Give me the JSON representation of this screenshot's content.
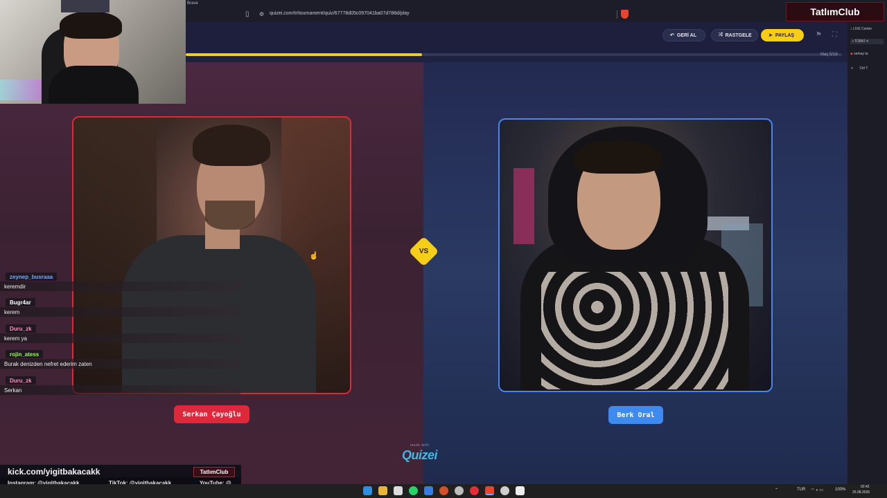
{
  "browser": {
    "app_name": "Brave",
    "url": "quizei.com/tr/tournament/quiz/67778d05c097041ba07d788d/play"
  },
  "header": {
    "back_label": "GERİ AL",
    "random_label": "RASTGELE",
    "share_label": "PAYLAŞ",
    "round_label": "Maç 5/16",
    "progress": 0.36
  },
  "match": {
    "left_name": "Serkan Çayoğlu",
    "right_name": "Berk Oral",
    "vs_label": "VS",
    "made_with": "made with",
    "logo": "Quizei"
  },
  "sidebar": {
    "items": [
      "LIVE Center",
      "TÜRKİ",
      "serkay ta",
      "Ctrl  T"
    ]
  },
  "stream": {
    "brand": "TatlımClub",
    "kick_url": "kick.com/yigitbakacakk",
    "badge": "TatlımClub",
    "instagram": "Instagram: @yigitbakacakk",
    "tiktok": "TikTok: @yigitbakacakk",
    "youtube": "YouTube: @"
  },
  "chat": [
    {
      "user": "zeynep_busraaa",
      "message": "keremdir",
      "color": "#7aa8ff"
    },
    {
      "user": "Bugr4ar",
      "message": "kerem",
      "color": "#ffffff"
    },
    {
      "user": "Duru_zk",
      "message": "kerem ya",
      "color": "#ff8fc0"
    },
    {
      "user": "rojin_atess",
      "message": "Burak denizden nefret ederim zaten",
      "color": "#9dff5a"
    },
    {
      "user": "Duru_zk",
      "message": "Serkan",
      "color": "#ff8fc0"
    }
  ],
  "taskbar": {
    "lang": "TUR",
    "battery": "100%",
    "time": "02:42",
    "date": "25.08.2026"
  },
  "colors": {
    "accent_yellow": "#f6cd17",
    "left_red": "#e0283b",
    "right_blue": "#3d8af0"
  }
}
